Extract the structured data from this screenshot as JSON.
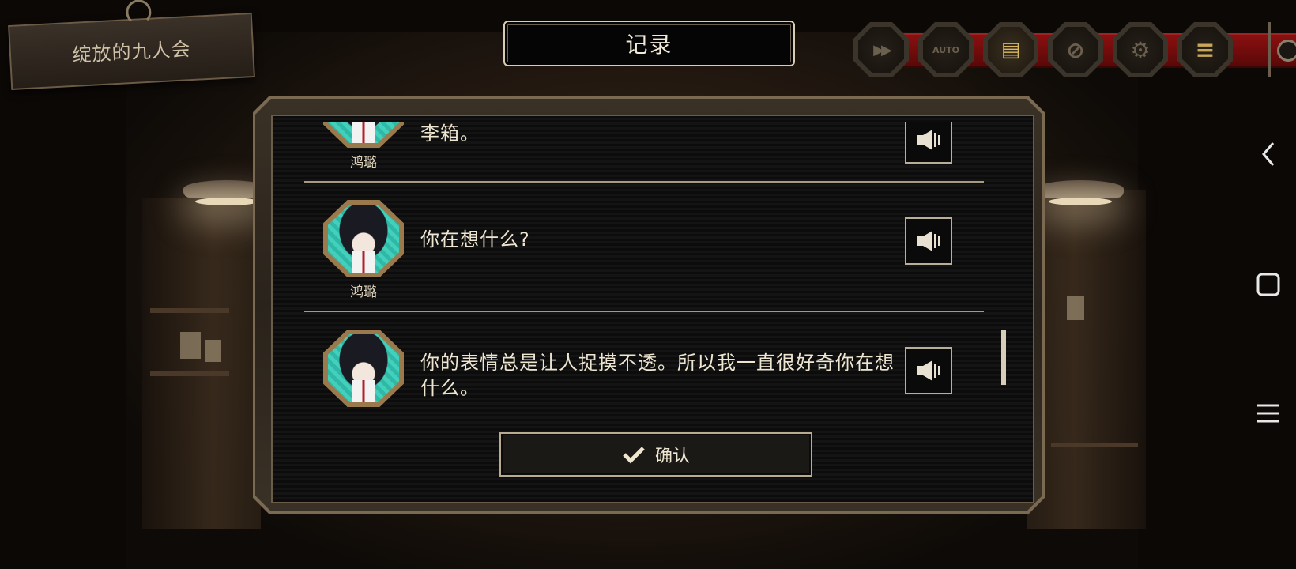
{
  "chapter_title": "绽放的九人会",
  "header": {
    "title": "记录"
  },
  "toolbar": {
    "buttons": [
      {
        "name": "fast-forward",
        "icon": "fast-forward-icon",
        "glyph": "▶▶"
      },
      {
        "name": "auto",
        "icon": "auto-icon",
        "glyph": "AUTO"
      },
      {
        "name": "log",
        "icon": "log-icon",
        "glyph": "▤"
      },
      {
        "name": "hide-ui",
        "icon": "hide-ui-icon",
        "glyph": "⊘"
      },
      {
        "name": "settings",
        "icon": "gear-icon",
        "glyph": "⚙"
      },
      {
        "name": "menu",
        "icon": "menu-icon",
        "glyph": "≡"
      }
    ]
  },
  "log": {
    "entries": [
      {
        "speaker": "鸿璐",
        "text": "李箱。"
      },
      {
        "speaker": "鸿璐",
        "text": "你在想什么?"
      },
      {
        "speaker": "",
        "text": "你的表情总是让人捉摸不透。所以我一直很好奇你在想什么。"
      }
    ],
    "confirm_label": "确认"
  },
  "colors": {
    "accent_gold": "#b9ae98",
    "portrait_teal": "#42d0bc",
    "toolbar_red": "#8a1010"
  }
}
